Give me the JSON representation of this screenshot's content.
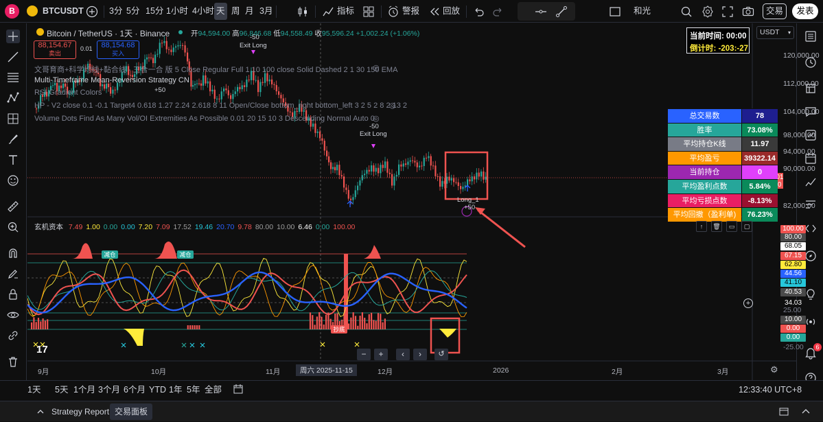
{
  "topbar": {
    "avatar_letter": "B",
    "symbol": "BTCUSDT",
    "intervals": [
      "3分",
      "5分",
      "15分",
      "1小时",
      "4小时",
      "天",
      "周",
      "月",
      "3月"
    ],
    "active_interval": "天",
    "indicators_label": "指标",
    "alert_label": "警报",
    "replay_label": "回放",
    "layout_name": "和光",
    "trade_button": "交易",
    "publish_button": "发表"
  },
  "chart": {
    "title": "Bitcoin / TetherUS · 1天 · Binance",
    "ohlc": {
      "o_label": "开",
      "o": "94,594.00",
      "h_label": "高",
      "h": "96,846.68",
      "l_label": "低",
      "l": "94,558.49",
      "c_label": "收",
      "c": "95,596.24",
      "chg": "+1,002.24 (+1.06%)"
    },
    "sell_price": "88,154.67",
    "sell_label": "卖出",
    "spread": "0.01",
    "buy_price": "88,154.68",
    "buy_label": "买入",
    "indicator_lines": [
      "文哥育商+科学均线+黏合线 - 三合一合 版 5 Close Regular Full 1 10 100 close Solid Dashed 2 1 30 150 EMA",
      "Multi-Timeframe Mean-Reversion Strategy CN",
      "RSI Gradient Colors",
      "HP - V2 close 0.1 -0.1 Target4 0.618 1.27 2.24 2.618 8 11 Open/Close bottom_right bottom_left 3 2 5 2 8 2 13 2",
      "Volume Dots Find As Many Vol/OI Extremities As Possible 0.01 20 15 10 3 Descending Normal Auto 0"
    ],
    "trade_markers": [
      {
        "text": "-50"
      },
      {
        "text": "Exit Long"
      },
      {
        "text": "+50"
      },
      {
        "text": "-50"
      },
      {
        "text": "Exit Long"
      },
      {
        "text": "Long_1"
      },
      {
        "text": "+50"
      }
    ],
    "time_box": {
      "now_label": "当前时间:",
      "now_value": "00:00",
      "countdown_label": "倒计时:",
      "countdown_value": "-203:-27"
    },
    "currency_selector": "USDT",
    "price_axis": [
      "120,000.00",
      "112,000.00",
      "104,000.00",
      "98,000.00",
      "94,000.00",
      "90,000.00",
      "82,000.00"
    ],
    "current_price": "88,140.01",
    "current_time": "19:26:20",
    "stats": [
      {
        "k": "总交易数",
        "v": "78",
        "kc": "#2962ff",
        "vc": "#1e1e8f"
      },
      {
        "k": "胜率",
        "v": "73.08%",
        "kc": "#26a69a",
        "vc": "#0a8a5a"
      },
      {
        "k": "平均持仓K线",
        "v": "11.97",
        "kc": "#787b86",
        "vc": "#3a3a3a"
      },
      {
        "k": "平均盈亏",
        "v": "39322.14",
        "kc": "#ff9800",
        "vc": "#9a2a2a"
      },
      {
        "k": "当前持仓",
        "v": "0",
        "kc": "#9c27b0",
        "vc": "#e040fb"
      },
      {
        "k": "平均盈利点数",
        "v": "5.84%",
        "kc": "#26a69a",
        "vc": "#0a8a5a"
      },
      {
        "k": "平均亏损点数",
        "v": "-8.13%",
        "kc": "#e91e63",
        "vc": "#9a1030"
      },
      {
        "k": "平均回撤（盈利单)",
        "v": "76.23%",
        "kc": "#ff9800",
        "vc": "#0a8a5a"
      }
    ]
  },
  "oscillator": {
    "name": "玄机资本",
    "values": [
      {
        "v": "7.49",
        "c": "#ef5350"
      },
      {
        "v": "1.00",
        "c": "#ffeb3b"
      },
      {
        "v": "0.00",
        "c": "#26a69a"
      },
      {
        "v": "0.00",
        "c": "#26c6da"
      },
      {
        "v": "7.20",
        "c": "#ffeb3b"
      },
      {
        "v": "7.09",
        "c": "#ef5350"
      },
      {
        "v": "17.52",
        "c": "#9e9e9e"
      },
      {
        "v": "19.46",
        "c": "#26c6da"
      },
      {
        "v": "20.70",
        "c": "#2962ff"
      },
      {
        "v": "9.78",
        "c": "#ef5350"
      },
      {
        "v": "80.00",
        "c": "#9e9e9e"
      },
      {
        "v": "10.00",
        "c": "#9e9e9e"
      },
      {
        "v": "6.46",
        "c": "#ffffff"
      },
      {
        "v": "0.00",
        "c": "#26a69a"
      },
      {
        "v": "100.00",
        "c": "#ef5350"
      }
    ],
    "badges": [
      "减仓",
      "减仓",
      "抄底"
    ],
    "axis_pills": [
      {
        "v": "100.00",
        "bg": "#ef5350",
        "fg": "#fff"
      },
      {
        "v": "80.00",
        "bg": "#4a4a4a",
        "fg": "#fff"
      },
      {
        "v": "68.05",
        "bg": "#ffffff",
        "fg": "#000"
      },
      {
        "v": "67.15",
        "bg": "#ef5350",
        "fg": "#fff"
      },
      {
        "v": "62.80",
        "bg": "#ffeb3b",
        "fg": "#000"
      },
      {
        "v": "44.56",
        "bg": "#2962ff",
        "fg": "#fff"
      },
      {
        "v": "41.10",
        "bg": "#26c6da",
        "fg": "#000"
      },
      {
        "v": "40.53",
        "bg": "#4a4a4a",
        "fg": "#fff"
      },
      {
        "v": "34.03",
        "bg": "#0f0f0f",
        "fg": "#fff"
      },
      {
        "v": "10.00",
        "bg": "#4a4a4a",
        "fg": "#fff"
      },
      {
        "v": "0.00",
        "bg": "#ef5350",
        "fg": "#fff"
      },
      {
        "v": "0.00",
        "bg": "#26a69a",
        "fg": "#fff"
      }
    ],
    "axis_plain": [
      "25.00",
      "-25.00"
    ]
  },
  "time_axis": [
    "9月",
    "10月",
    "11月",
    "12月",
    "2026",
    "2月",
    "3月"
  ],
  "crosshair_date": "周六 2025-11-15",
  "ranges": [
    "1天",
    "5天",
    "1个月",
    "3个月",
    "6个月",
    "YTD",
    "1年",
    "5年",
    "全部"
  ],
  "clock": "12:33:40 UTC+8",
  "footer_tabs": [
    "Strategy Report",
    "交易面板"
  ],
  "colors": {
    "up": "#26a69a",
    "down": "#ef5350",
    "highlight": "#ef5350"
  }
}
